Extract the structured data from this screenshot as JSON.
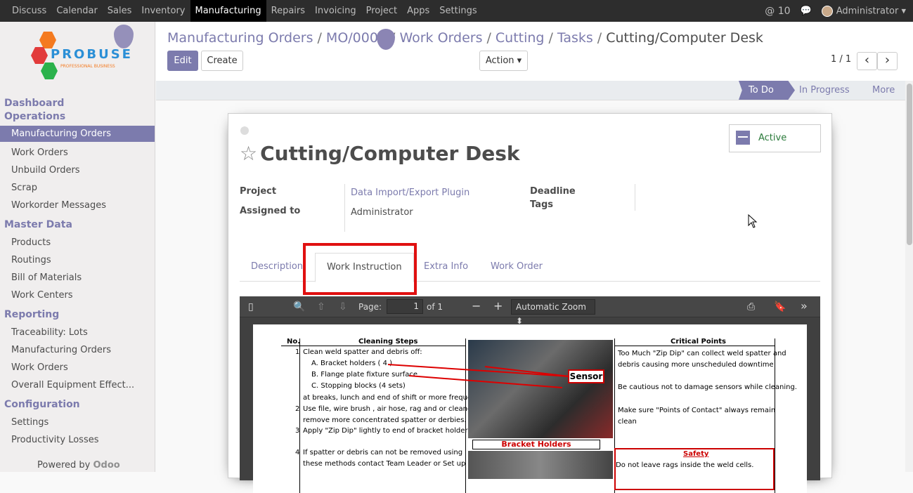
{
  "topbar": {
    "menu": [
      "Discuss",
      "Calendar",
      "Sales",
      "Inventory",
      "Manufacturing",
      "Repairs",
      "Invoicing",
      "Project",
      "Apps",
      "Settings"
    ],
    "active_menu": "Manufacturing",
    "mentions": "@ 10",
    "user": "Administrator ▾"
  },
  "logo": {
    "brand": "PROBUSE",
    "tagline": "PROFESSIONAL BUSINESS"
  },
  "sidebar": {
    "sections": [
      {
        "title": "Dashboard",
        "items": []
      },
      {
        "title": "Operations",
        "items": [
          "Manufacturing Orders",
          "Work Orders",
          "Unbuild Orders",
          "Scrap",
          "Workorder Messages"
        ]
      },
      {
        "title": "Master Data",
        "items": [
          "Products",
          "Routings",
          "Bill of Materials",
          "Work Centers"
        ]
      },
      {
        "title": "Reporting",
        "items": [
          "Traceability: Lots",
          "Manufacturing Orders",
          "Work Orders",
          "Overall Equipment Effect..."
        ]
      },
      {
        "title": "Configuration",
        "items": [
          "Settings",
          "Productivity Losses"
        ]
      }
    ],
    "active_item": "Manufacturing Orders",
    "powered_by": "Powered by",
    "powered_brand": "Odoo"
  },
  "breadcrumb": {
    "items": [
      "Manufacturing Orders",
      "MO/0001",
      "Work Orders",
      "Cutting",
      "Tasks"
    ],
    "current": "Cutting/Computer Desk"
  },
  "buttons": {
    "edit": "Edit",
    "create": "Create",
    "action": "Action ▾"
  },
  "pager": {
    "value": "1 / 1",
    "prev": "‹",
    "next": "›"
  },
  "status": {
    "steps": [
      "To Do",
      "In Progress",
      "More"
    ],
    "current": "To Do"
  },
  "record": {
    "title": "Cutting/Computer Desk",
    "active_label": "Active",
    "fields": {
      "project_label": "Project",
      "project_value": "Data Import/Export Plugin",
      "assigned_label": "Assigned to",
      "assigned_value": "Administrator",
      "deadline_label": "Deadline",
      "tags_label": "Tags"
    },
    "tabs": [
      "Description",
      "Work Instruction",
      "Extra Info",
      "Work Order"
    ],
    "active_tab": "Work Instruction"
  },
  "pdf_viewer": {
    "page_label": "Page:",
    "page_value": "1",
    "page_of": "of 1",
    "zoom": "Automatic Zoom ⬍"
  },
  "pdf_doc": {
    "col_no": "No.",
    "col_steps": "Cleaning Steps",
    "col_critical": "Critical Points",
    "steps": [
      {
        "no": "1",
        "text": "Clean weld spatter and debris off:"
      },
      {
        "no": "",
        "text": "A. Bracket holders ( 4 )"
      },
      {
        "no": "",
        "text": "B. Flange plate fixture surface"
      },
      {
        "no": "",
        "text": "C. Stopping blocks (4 sets)"
      },
      {
        "no": "",
        "text": "at breaks, lunch and end of shift or more frequently"
      },
      {
        "no": "2",
        "text": "Use file, wire brush , air hose, rag and or cleaner to"
      },
      {
        "no": "",
        "text": "remove more concentrated spatter or derbies."
      },
      {
        "no": "3",
        "text": "Apply \"Zip Dip\" lightly to end of bracket holders"
      },
      {
        "no": "4",
        "text": "If spatter or debris can not be removed using"
      },
      {
        "no": "",
        "text": "these methods contact Team Leader or Set up"
      }
    ],
    "critical": [
      "Too Much \"Zip Dip\" can collect weld spatter and",
      "debris causing more unscheduled downtime",
      "Be cautious not to damage sensors while cleaning.",
      "Make sure \"Points of Contact\" always remain",
      "clean"
    ],
    "sensor_label": "Sensor",
    "bracket_label": "Bracket Holders",
    "safety_title": "Safety",
    "safety_text": "Do not leave rags inside the weld cells."
  }
}
